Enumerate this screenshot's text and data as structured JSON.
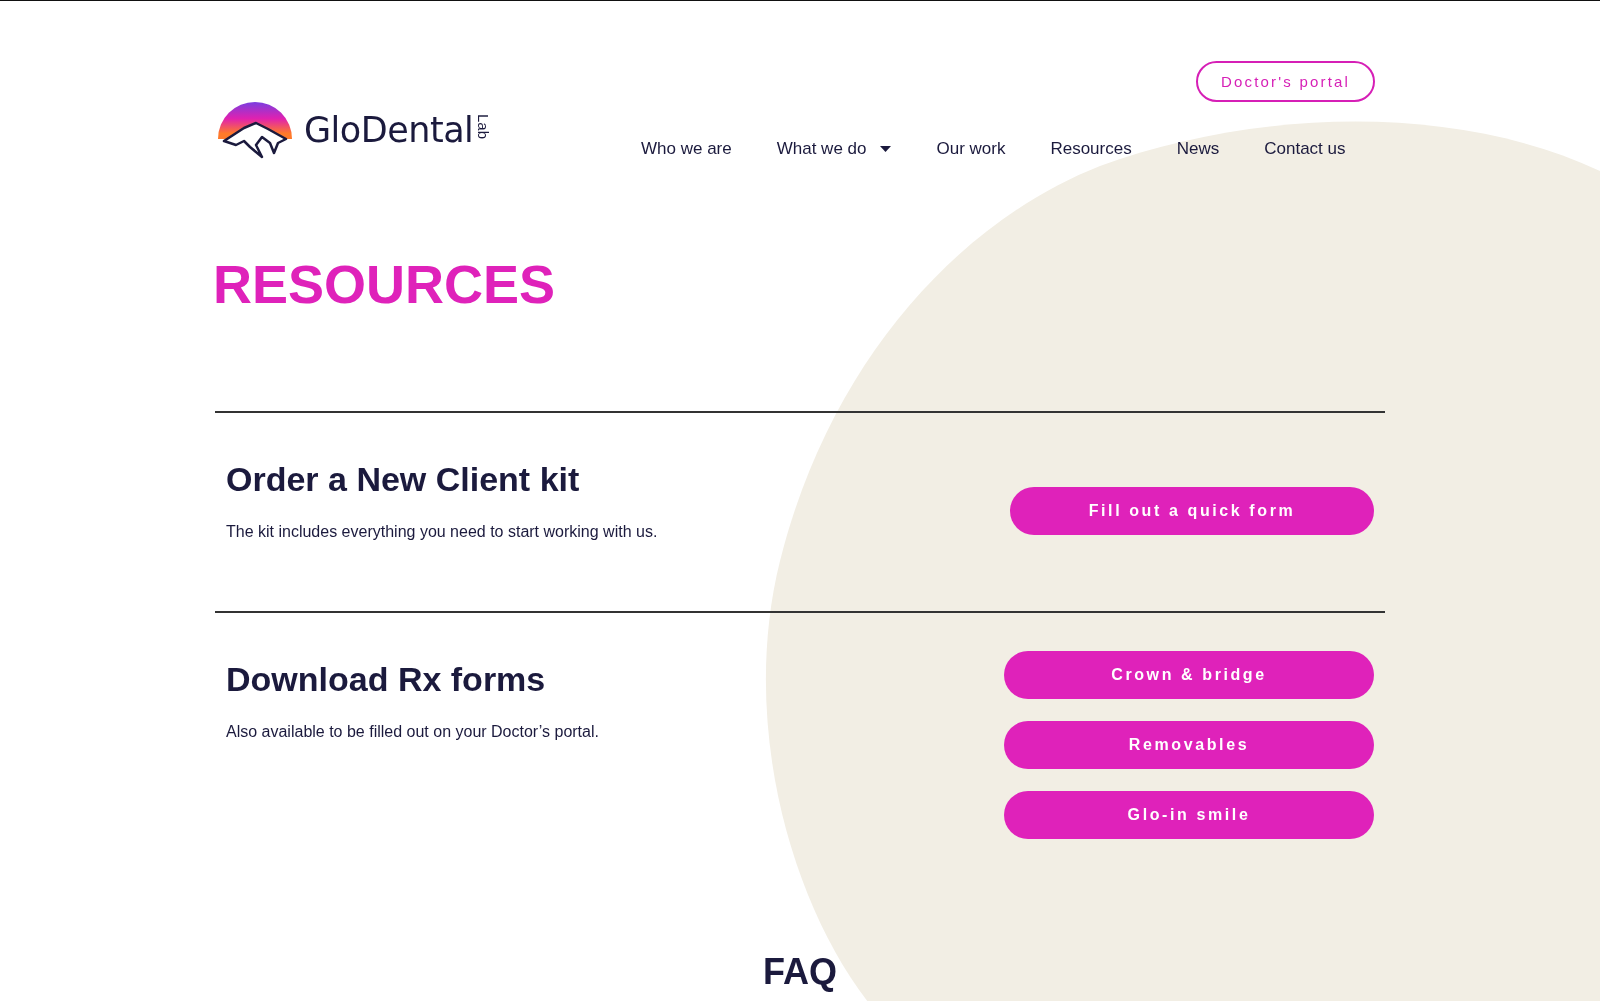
{
  "header": {
    "logo": {
      "name": "GloDental",
      "suffix": "Lab"
    },
    "portal_button": "Doctor's portal",
    "nav": [
      {
        "label": "Who we are",
        "dropdown": false
      },
      {
        "label": "What we do",
        "dropdown": true
      },
      {
        "label": "Our work",
        "dropdown": false
      },
      {
        "label": "Resources",
        "dropdown": false
      },
      {
        "label": "News",
        "dropdown": false
      },
      {
        "label": "Contact us",
        "dropdown": false
      }
    ]
  },
  "page_title": "RESOURCES",
  "sections": [
    {
      "title": "Order a New Client kit",
      "text": "The kit includes everything you need to start working with us.",
      "buttons": [
        "Fill out a quick form"
      ]
    },
    {
      "title": "Download Rx forms",
      "text": "Also available to be filled out on your Doctor’s portal.",
      "buttons": [
        "Crown & bridge",
        "Removables",
        "Glo-in smile"
      ]
    }
  ],
  "faq_heading": "FAQ"
}
